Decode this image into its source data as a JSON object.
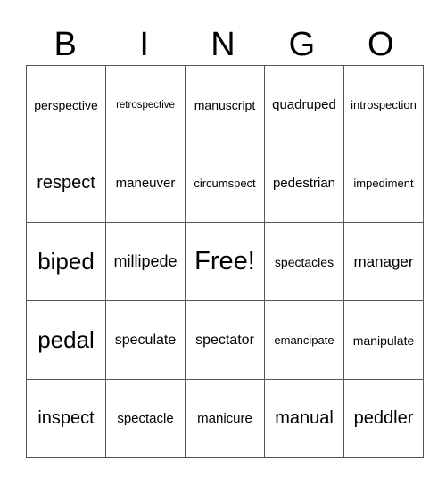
{
  "header": {
    "letters": [
      "B",
      "I",
      "N",
      "G",
      "O"
    ]
  },
  "board": {
    "rows": [
      [
        "perspective",
        "retrospective",
        "manuscript",
        "quadruped",
        "introspection"
      ],
      [
        "respect",
        "maneuver",
        "circumspect",
        "pedestrian",
        "impediment"
      ],
      [
        "biped",
        "millipede",
        "Free!",
        "spectacles",
        "manager"
      ],
      [
        "pedal",
        "speculate",
        "spectator",
        "emancipate",
        "manipulate"
      ],
      [
        "inspect",
        "spectacle",
        "manicure",
        "manual",
        "peddler"
      ]
    ]
  }
}
